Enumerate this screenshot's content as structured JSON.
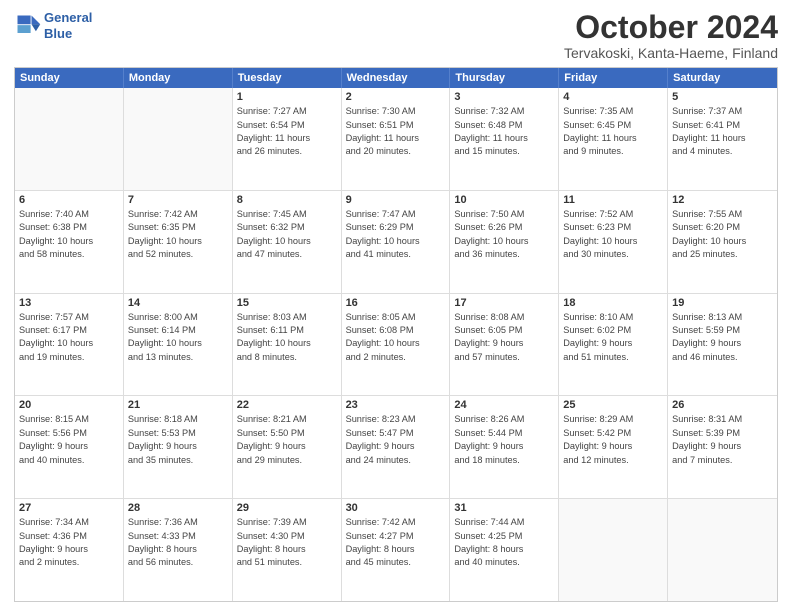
{
  "logo": {
    "line1": "General",
    "line2": "Blue"
  },
  "title": "October 2024",
  "subtitle": "Tervakoski, Kanta-Haeme, Finland",
  "header_days": [
    "Sunday",
    "Monday",
    "Tuesday",
    "Wednesday",
    "Thursday",
    "Friday",
    "Saturday"
  ],
  "weeks": [
    [
      {
        "day": "",
        "lines": []
      },
      {
        "day": "",
        "lines": []
      },
      {
        "day": "1",
        "lines": [
          "Sunrise: 7:27 AM",
          "Sunset: 6:54 PM",
          "Daylight: 11 hours",
          "and 26 minutes."
        ]
      },
      {
        "day": "2",
        "lines": [
          "Sunrise: 7:30 AM",
          "Sunset: 6:51 PM",
          "Daylight: 11 hours",
          "and 20 minutes."
        ]
      },
      {
        "day": "3",
        "lines": [
          "Sunrise: 7:32 AM",
          "Sunset: 6:48 PM",
          "Daylight: 11 hours",
          "and 15 minutes."
        ]
      },
      {
        "day": "4",
        "lines": [
          "Sunrise: 7:35 AM",
          "Sunset: 6:45 PM",
          "Daylight: 11 hours",
          "and 9 minutes."
        ]
      },
      {
        "day": "5",
        "lines": [
          "Sunrise: 7:37 AM",
          "Sunset: 6:41 PM",
          "Daylight: 11 hours",
          "and 4 minutes."
        ]
      }
    ],
    [
      {
        "day": "6",
        "lines": [
          "Sunrise: 7:40 AM",
          "Sunset: 6:38 PM",
          "Daylight: 10 hours",
          "and 58 minutes."
        ]
      },
      {
        "day": "7",
        "lines": [
          "Sunrise: 7:42 AM",
          "Sunset: 6:35 PM",
          "Daylight: 10 hours",
          "and 52 minutes."
        ]
      },
      {
        "day": "8",
        "lines": [
          "Sunrise: 7:45 AM",
          "Sunset: 6:32 PM",
          "Daylight: 10 hours",
          "and 47 minutes."
        ]
      },
      {
        "day": "9",
        "lines": [
          "Sunrise: 7:47 AM",
          "Sunset: 6:29 PM",
          "Daylight: 10 hours",
          "and 41 minutes."
        ]
      },
      {
        "day": "10",
        "lines": [
          "Sunrise: 7:50 AM",
          "Sunset: 6:26 PM",
          "Daylight: 10 hours",
          "and 36 minutes."
        ]
      },
      {
        "day": "11",
        "lines": [
          "Sunrise: 7:52 AM",
          "Sunset: 6:23 PM",
          "Daylight: 10 hours",
          "and 30 minutes."
        ]
      },
      {
        "day": "12",
        "lines": [
          "Sunrise: 7:55 AM",
          "Sunset: 6:20 PM",
          "Daylight: 10 hours",
          "and 25 minutes."
        ]
      }
    ],
    [
      {
        "day": "13",
        "lines": [
          "Sunrise: 7:57 AM",
          "Sunset: 6:17 PM",
          "Daylight: 10 hours",
          "and 19 minutes."
        ]
      },
      {
        "day": "14",
        "lines": [
          "Sunrise: 8:00 AM",
          "Sunset: 6:14 PM",
          "Daylight: 10 hours",
          "and 13 minutes."
        ]
      },
      {
        "day": "15",
        "lines": [
          "Sunrise: 8:03 AM",
          "Sunset: 6:11 PM",
          "Daylight: 10 hours",
          "and 8 minutes."
        ]
      },
      {
        "day": "16",
        "lines": [
          "Sunrise: 8:05 AM",
          "Sunset: 6:08 PM",
          "Daylight: 10 hours",
          "and 2 minutes."
        ]
      },
      {
        "day": "17",
        "lines": [
          "Sunrise: 8:08 AM",
          "Sunset: 6:05 PM",
          "Daylight: 9 hours",
          "and 57 minutes."
        ]
      },
      {
        "day": "18",
        "lines": [
          "Sunrise: 8:10 AM",
          "Sunset: 6:02 PM",
          "Daylight: 9 hours",
          "and 51 minutes."
        ]
      },
      {
        "day": "19",
        "lines": [
          "Sunrise: 8:13 AM",
          "Sunset: 5:59 PM",
          "Daylight: 9 hours",
          "and 46 minutes."
        ]
      }
    ],
    [
      {
        "day": "20",
        "lines": [
          "Sunrise: 8:15 AM",
          "Sunset: 5:56 PM",
          "Daylight: 9 hours",
          "and 40 minutes."
        ]
      },
      {
        "day": "21",
        "lines": [
          "Sunrise: 8:18 AM",
          "Sunset: 5:53 PM",
          "Daylight: 9 hours",
          "and 35 minutes."
        ]
      },
      {
        "day": "22",
        "lines": [
          "Sunrise: 8:21 AM",
          "Sunset: 5:50 PM",
          "Daylight: 9 hours",
          "and 29 minutes."
        ]
      },
      {
        "day": "23",
        "lines": [
          "Sunrise: 8:23 AM",
          "Sunset: 5:47 PM",
          "Daylight: 9 hours",
          "and 24 minutes."
        ]
      },
      {
        "day": "24",
        "lines": [
          "Sunrise: 8:26 AM",
          "Sunset: 5:44 PM",
          "Daylight: 9 hours",
          "and 18 minutes."
        ]
      },
      {
        "day": "25",
        "lines": [
          "Sunrise: 8:29 AM",
          "Sunset: 5:42 PM",
          "Daylight: 9 hours",
          "and 12 minutes."
        ]
      },
      {
        "day": "26",
        "lines": [
          "Sunrise: 8:31 AM",
          "Sunset: 5:39 PM",
          "Daylight: 9 hours",
          "and 7 minutes."
        ]
      }
    ],
    [
      {
        "day": "27",
        "lines": [
          "Sunrise: 7:34 AM",
          "Sunset: 4:36 PM",
          "Daylight: 9 hours",
          "and 2 minutes."
        ]
      },
      {
        "day": "28",
        "lines": [
          "Sunrise: 7:36 AM",
          "Sunset: 4:33 PM",
          "Daylight: 8 hours",
          "and 56 minutes."
        ]
      },
      {
        "day": "29",
        "lines": [
          "Sunrise: 7:39 AM",
          "Sunset: 4:30 PM",
          "Daylight: 8 hours",
          "and 51 minutes."
        ]
      },
      {
        "day": "30",
        "lines": [
          "Sunrise: 7:42 AM",
          "Sunset: 4:27 PM",
          "Daylight: 8 hours",
          "and 45 minutes."
        ]
      },
      {
        "day": "31",
        "lines": [
          "Sunrise: 7:44 AM",
          "Sunset: 4:25 PM",
          "Daylight: 8 hours",
          "and 40 minutes."
        ]
      },
      {
        "day": "",
        "lines": []
      },
      {
        "day": "",
        "lines": []
      }
    ]
  ]
}
